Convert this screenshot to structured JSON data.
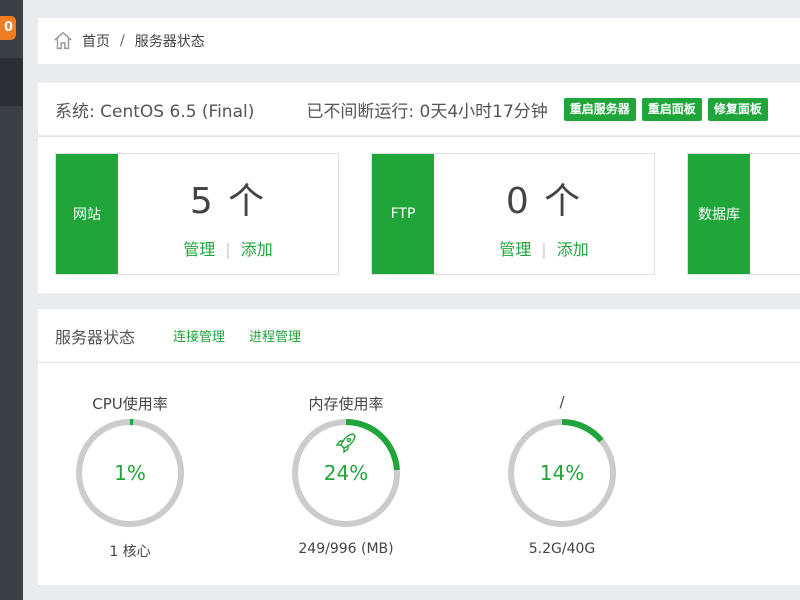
{
  "sidebar": {
    "badge": "0"
  },
  "breadcrumb": {
    "home": "首页",
    "sep": "/",
    "current": "服务器状态"
  },
  "system": {
    "os": "系统: CentOS 6.5 (Final)",
    "uptime": "已不间断运行: 0天4小时17分钟",
    "buttons": [
      "重启服务器",
      "重启面板",
      "修复面板"
    ]
  },
  "cards": [
    {
      "tag": "网站",
      "count": "5 个",
      "manage": "管理",
      "add": "添加"
    },
    {
      "tag": "FTP",
      "count": "0 个",
      "manage": "管理",
      "add": "添加"
    },
    {
      "tag": "数据库"
    }
  ],
  "status": {
    "title": "服务器状态",
    "links": [
      "连接管理",
      "进程管理"
    ],
    "gauges": [
      {
        "title": "CPU使用率",
        "percent": 1,
        "label": "1%",
        "sub": "1 核心",
        "icon": ""
      },
      {
        "title": "内存使用率",
        "percent": 24,
        "label": "24%",
        "sub": "249/996 (MB)",
        "icon": "rocket-icon"
      },
      {
        "title": "/",
        "percent": 14,
        "label": "14%",
        "sub": "5.2G/40G",
        "icon": ""
      }
    ]
  },
  "colors": {
    "accent": "#20a53a",
    "track": "#cccccc",
    "badge": "#f07c22",
    "sidebar": "#3a3f44"
  }
}
